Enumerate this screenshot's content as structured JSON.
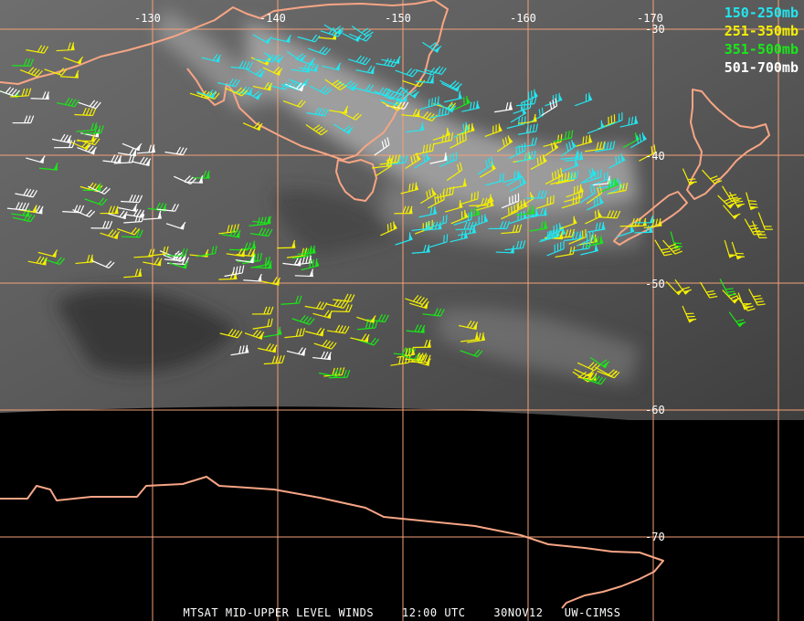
{
  "colors": {
    "coast": "#f7a585",
    "grid": "#f4a178",
    "background": "#000000",
    "text": "#ffffff"
  },
  "longitude_labels": [
    "-130",
    "-140",
    "-150",
    "-160",
    "-170"
  ],
  "latitude_labels": [
    "-30",
    "-40",
    "-50",
    "-60",
    "-70"
  ],
  "legend": [
    {
      "label": "150-250mb",
      "color": "#22e6f0"
    },
    {
      "label": "251-350mb",
      "color": "#f5f000"
    },
    {
      "label": "351-500mb",
      "color": "#18e818"
    },
    {
      "label": "501-700mb",
      "color": "#ffffff"
    }
  ],
  "caption": {
    "product": "MTSAT MID-UPPER LEVEL WINDS",
    "time": "12:00 UTC",
    "date": "30NOV12",
    "source": "UW-CIMSS"
  }
}
